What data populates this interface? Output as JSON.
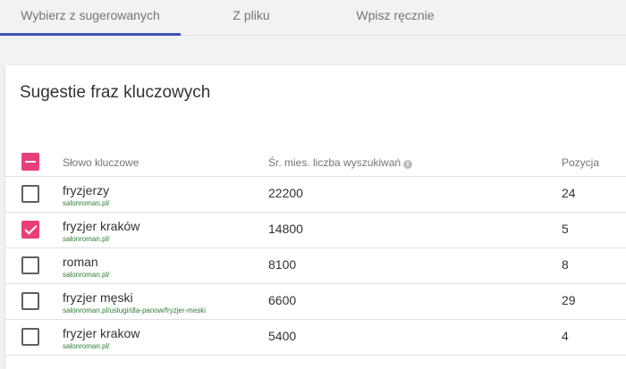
{
  "tabs": [
    {
      "label": "Wybierz z sugerowanych"
    },
    {
      "label": "Z pliku"
    },
    {
      "label": "Wpisz ręcznie"
    }
  ],
  "card": {
    "title": "Sugestie fraz kluczowych"
  },
  "table": {
    "headers": {
      "keyword": "Słowo kluczowe",
      "avg": "Śr. mies. liczba wyszukiwań",
      "position": "Pozycja"
    },
    "select_all_state": "indeterminate",
    "rows": [
      {
        "keyword": "fryzjerzy",
        "url": "salonroman.pl/",
        "avg": "22200",
        "position": "24",
        "checked": false
      },
      {
        "keyword": "fryzjer kraków",
        "url": "salonroman.pl/",
        "avg": "14800",
        "position": "5",
        "checked": true
      },
      {
        "keyword": "roman",
        "url": "salonroman.pl/",
        "avg": "8100",
        "position": "8",
        "checked": false
      },
      {
        "keyword": "fryzjer męski",
        "url": "salonroman.pl/uslugi/dla-panow/fryzjer-meski",
        "avg": "6600",
        "position": "29",
        "checked": false
      },
      {
        "keyword": "fryzjer krakow",
        "url": "salonroman.pl/",
        "avg": "5400",
        "position": "4",
        "checked": false
      }
    ]
  },
  "colors": {
    "accent": "#e83e79",
    "tab_indicator": "#3f51b5",
    "url_green": "#2e7d32"
  }
}
